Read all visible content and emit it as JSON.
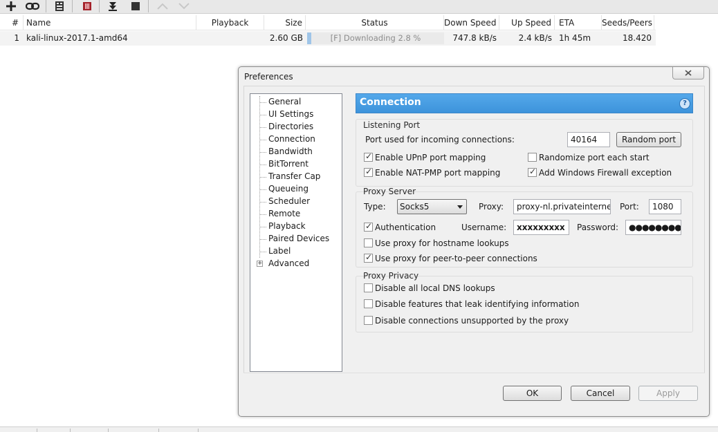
{
  "toolbar": {
    "icons": [
      "add-icon",
      "add-url-icon",
      "create-torrent-icon",
      "remove-icon",
      "download-icon",
      "stop-icon",
      "up-icon",
      "down-icon"
    ]
  },
  "list": {
    "columns": [
      "#",
      "Name",
      "Playback",
      "Size",
      "Status",
      "Down Speed",
      "Up Speed",
      "ETA",
      "Seeds/Peers"
    ],
    "rows": [
      {
        "num": "1",
        "name": "kali-linux-2017.1-amd64",
        "playback": "",
        "size": "2.60 GB",
        "status": "[F] Downloading 2.8 %",
        "progress": 0.028,
        "down": "747.8 kB/s",
        "up": "2.4 kB/s",
        "eta": "1h 45m",
        "seeds": "18.420"
      }
    ]
  },
  "dialog": {
    "title": "Preferences",
    "tree": [
      "General",
      "UI Settings",
      "Directories",
      "Connection",
      "Bandwidth",
      "BitTorrent",
      "Transfer Cap",
      "Queueing",
      "Scheduler",
      "Remote",
      "Playback",
      "Paired Devices",
      "Label",
      "Advanced"
    ],
    "pane_title": "Connection",
    "listening": {
      "title": "Listening Port",
      "port_label": "Port used for incoming connections:",
      "port_value": "40164",
      "random_btn": "Random port",
      "upnp": "Enable UPnP port mapping",
      "randomize": "Randomize port each start",
      "natpmp": "Enable NAT-PMP port mapping",
      "firewall": "Add Windows Firewall exception"
    },
    "proxy": {
      "title": "Proxy Server",
      "type_label": "Type:",
      "type_value": "Socks5",
      "proxy_label": "Proxy:",
      "proxy_value": "proxy-nl.privateinternetac",
      "port_label": "Port:",
      "port_value": "1080",
      "auth": "Authentication",
      "username_label": "Username:",
      "username_value": "xxxxxxxxx",
      "password_label": "Password:",
      "password_value": "●●●●●●●●●●",
      "hostname": "Use proxy for hostname lookups",
      "p2p": "Use proxy for peer-to-peer connections"
    },
    "privacy": {
      "title": "Proxy Privacy",
      "dns": "Disable all local DNS lookups",
      "leak": "Disable features that leak identifying information",
      "unsupported": "Disable connections unsupported by the proxy"
    },
    "buttons": {
      "ok": "OK",
      "cancel": "Cancel",
      "apply": "Apply"
    },
    "help_glyph": "?"
  }
}
